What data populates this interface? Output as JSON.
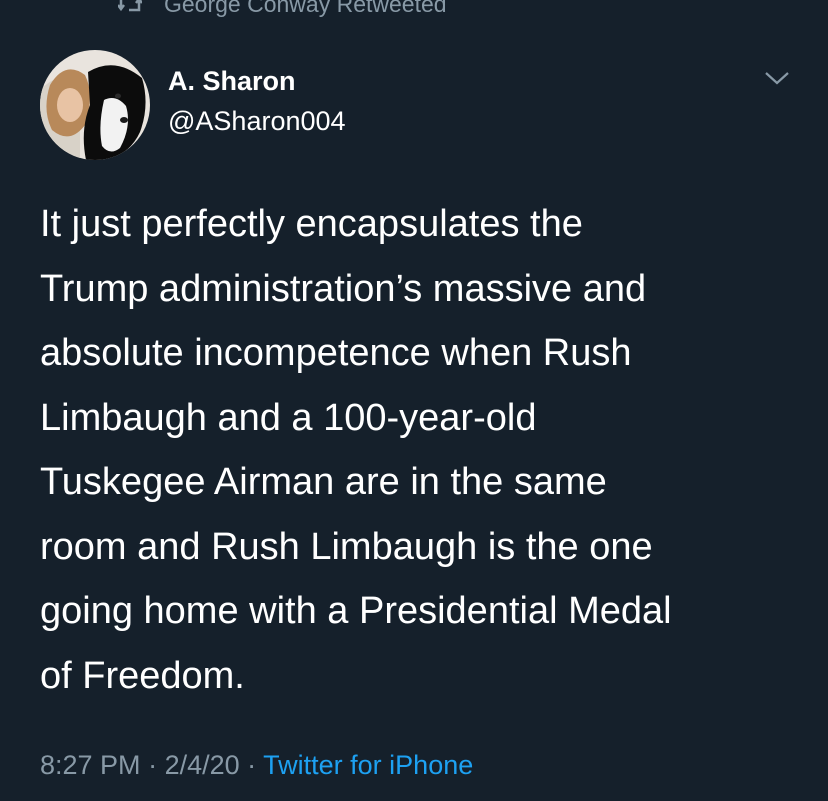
{
  "retweet": {
    "text": "George Conway Retweeted"
  },
  "author": {
    "display_name": "A. Sharon",
    "handle": "@ASharon004"
  },
  "tweet": {
    "lines": [
      "It just perfectly encapsulates the",
      "Trump administration’s massive and",
      "absolute incompetence when Rush",
      "Limbaugh and a 100-year-old",
      "Tuskegee Airman are in the same",
      "room and Rush Limbaugh is the one",
      "going home with a Presidential Medal",
      "of Freedom."
    ]
  },
  "meta": {
    "time": "8:27 PM",
    "date": "2/4/20",
    "separator": " · ",
    "source": "Twitter for iPhone"
  },
  "colors": {
    "background": "#15202b",
    "text": "#ffffff",
    "secondary": "#8899a6",
    "accent": "#1da1f2"
  },
  "icons": {
    "retweet": "retweet-icon",
    "menu": "chevron-down-icon",
    "avatar": "avatar-photo"
  }
}
